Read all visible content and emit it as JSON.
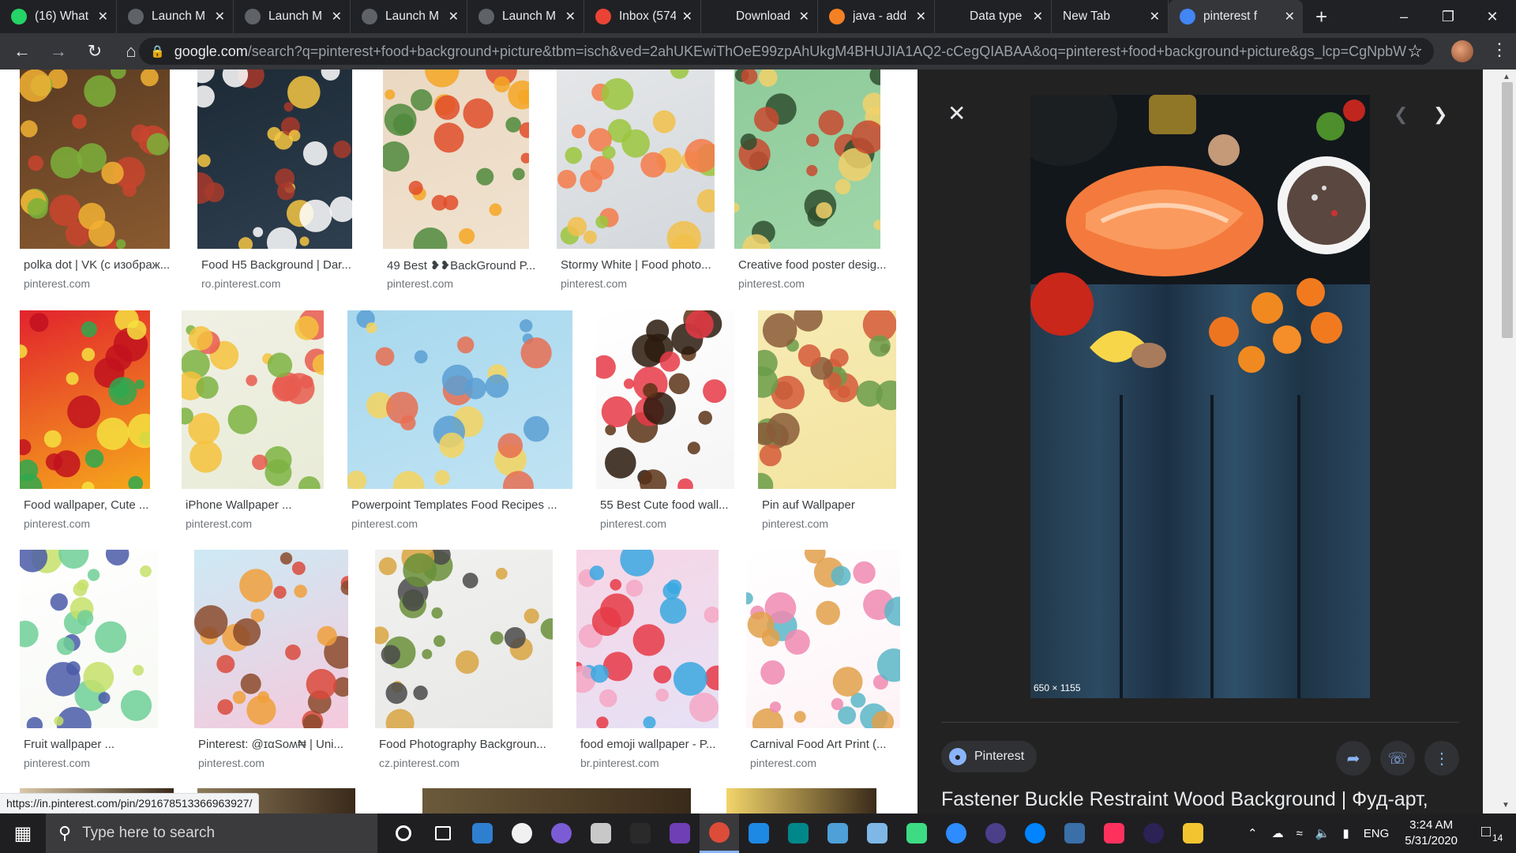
{
  "browser": {
    "tabs": [
      {
        "label": "(16) What",
        "favicon": "whatsapp-icon",
        "color": "#25d366"
      },
      {
        "label": "Launch M",
        "favicon": "globe-icon",
        "color": "#5f6368"
      },
      {
        "label": "Launch M",
        "favicon": "globe-icon",
        "color": "#5f6368"
      },
      {
        "label": "Launch M",
        "favicon": "globe-icon",
        "color": "#5f6368"
      },
      {
        "label": "Launch M",
        "favicon": "globe-icon",
        "color": "#5f6368"
      },
      {
        "label": "Inbox (574",
        "favicon": "gmail-icon",
        "color": "#ea4335"
      },
      {
        "label": "Download",
        "favicon": "download-icon",
        "color": "#202124"
      },
      {
        "label": "java - add",
        "favicon": "stackoverflow-icon",
        "color": "#f48024"
      },
      {
        "label": "Data type",
        "favicon": "play-icon",
        "color": "#202124"
      },
      {
        "label": "New Tab",
        "favicon": "",
        "color": ""
      },
      {
        "label": "pinterest f",
        "favicon": "google-icon",
        "color": "#4285f4"
      }
    ],
    "url_domain": "google.com",
    "url_rest": "/search?q=pinterest+food+background+picture&tbm=isch&ved=2ahUKEwiThOeE99zpAhUkgM4BHUJIA1AQ2-cCegQIABAA&oq=pinterest+food+background+picture&gs_lcp=CgNpbWc..."
  },
  "results": [
    {
      "title": "polka dot | VK (с изображ...",
      "source": "pinterest.com",
      "colors": [
        "#5a3b22",
        "#8a5a30",
        "#c9442e",
        "#7bb03a",
        "#f2b134"
      ]
    },
    {
      "title": "Food H5 Background | Dar...",
      "source": "ro.pinterest.com",
      "colors": [
        "#1d2a36",
        "#2e3f4f",
        "#f5c542",
        "#ffffff",
        "#a83a2c"
      ]
    },
    {
      "title": "49 Best ❥❥BackGround P...",
      "source": "pinterest.com",
      "colors": [
        "#ead8c2",
        "#f0e2cf",
        "#e04e2a",
        "#f4a623",
        "#4f8a3c"
      ]
    },
    {
      "title": "Stormy White | Food photo...",
      "source": "pinterest.com",
      "colors": [
        "#e4e6e8",
        "#d4d8dc",
        "#f47a4a",
        "#9bc53d",
        "#f2c04a"
      ]
    },
    {
      "title": "Creative food poster desig...",
      "source": "pinterest.com",
      "colors": [
        "#8fcb9b",
        "#9fd6a9",
        "#2f4f2f",
        "#f2d16b",
        "#c94a30"
      ]
    },
    {
      "title": "Food wallpaper, Cute ...",
      "source": "pinterest.com",
      "colors": [
        "#e2232d",
        "#f6a81b",
        "#2fa84f",
        "#f5e040",
        "#c1121f"
      ]
    },
    {
      "title": "iPhone Wallpaper ...",
      "source": "pinterest.com",
      "colors": [
        "#f0f0e4",
        "#e9ecd8",
        "#e85a4f",
        "#7cb342",
        "#f5c23c"
      ]
    },
    {
      "title": "Powerpoint Templates Food Recipes ...",
      "source": "pinterest.com",
      "colors": [
        "#a8d8ee",
        "#bfe3f3",
        "#5a9fd4",
        "#f4d35e",
        "#e76f51"
      ]
    },
    {
      "title": "55 Best Cute food wall...",
      "source": "pinterest.com",
      "colors": [
        "#ffffff",
        "#f5f5f5",
        "#5c3316",
        "#e63946",
        "#2b1a0e"
      ]
    },
    {
      "title": "Pin auf Wallpaper",
      "source": "pinterest.com",
      "colors": [
        "#f6ebb4",
        "#f4e4a0",
        "#d35b3a",
        "#6a9c4a",
        "#8a5c3a"
      ]
    },
    {
      "title": "Fruit wallpaper ...",
      "source": "pinterest.com",
      "colors": [
        "#ffffff",
        "#f7f9f4",
        "#6fcf97",
        "#4a5aa8",
        "#c6e06a"
      ]
    },
    {
      "title": "Pinterest: @ɪαSᴏʍ₦ | Uni...",
      "source": "pinterest.com",
      "colors": [
        "#cdeaf5",
        "#f5c9dc",
        "#f0a03b",
        "#8b4a2b",
        "#d94a3c"
      ]
    },
    {
      "title": "Food Photography Backgroun...",
      "source": "cz.pinterest.com",
      "colors": [
        "#f1f1ef",
        "#e8e8e6",
        "#6a8f3a",
        "#d9a441",
        "#4a4a4a"
      ]
    },
    {
      "title": "food emoji wallpaper - P...",
      "source": "br.pinterest.com",
      "colors": [
        "#f7d6e6",
        "#e6e1f5",
        "#e63946",
        "#3aa8e0",
        "#f4a7c4"
      ]
    },
    {
      "title": "Carnival Food Art Print (...",
      "source": "pinterest.com",
      "colors": [
        "#ffffff",
        "#fdf3f6",
        "#f08ab0",
        "#e2a04a",
        "#5ab6c8"
      ]
    }
  ],
  "status_url": "https://in.pinterest.com/pin/291678513366963927/",
  "preview": {
    "dimensions": "650 × 1155",
    "source_name": "Pinterest",
    "title": "Fastener Buckle Restraint Wood Background | Фуд-арт,"
  },
  "taskbar": {
    "search_placeholder": "Type here to search",
    "language": "ENG",
    "time": "3:24 AM",
    "date": "5/31/2020",
    "notification_count": "14",
    "apps": [
      {
        "icon": "cortana-icon",
        "color": "#ffffff"
      },
      {
        "icon": "task-view-icon",
        "color": "#ffffff"
      },
      {
        "icon": "mail-icon",
        "color": "#2f7fd1"
      },
      {
        "icon": "itunes-icon",
        "color": "#f1f1f1"
      },
      {
        "icon": "podcast-icon",
        "color": "#7b5cd6"
      },
      {
        "icon": "vscode-icon",
        "color": "#c8c8c8"
      },
      {
        "icon": "epic-games-icon",
        "color": "#2a2a2a"
      },
      {
        "icon": "visual-studio-icon",
        "color": "#6e3fb5"
      },
      {
        "icon": "chrome-icon",
        "color": "#dd4b39"
      },
      {
        "icon": "instagram-icon",
        "color": "#1e88e5"
      },
      {
        "icon": "arduino-icon",
        "color": "#00878a"
      },
      {
        "icon": "package-icon",
        "color": "#4f9fd8"
      },
      {
        "icon": "notepad-icon",
        "color": "#7fb8e6"
      },
      {
        "icon": "android-studio-icon",
        "color": "#3ddc84"
      },
      {
        "icon": "zoom-icon",
        "color": "#2d8cff"
      },
      {
        "icon": "eclipse-icon",
        "color": "#4b3f8a"
      },
      {
        "icon": "messenger-icon",
        "color": "#0084ff"
      },
      {
        "icon": "sql-icon",
        "color": "#3a6fa8"
      },
      {
        "icon": "intellij-icon",
        "color": "#fe315d"
      },
      {
        "icon": "eclipse2-icon",
        "color": "#2c2255"
      },
      {
        "icon": "file-explorer-icon",
        "color": "#f4c430"
      }
    ]
  }
}
